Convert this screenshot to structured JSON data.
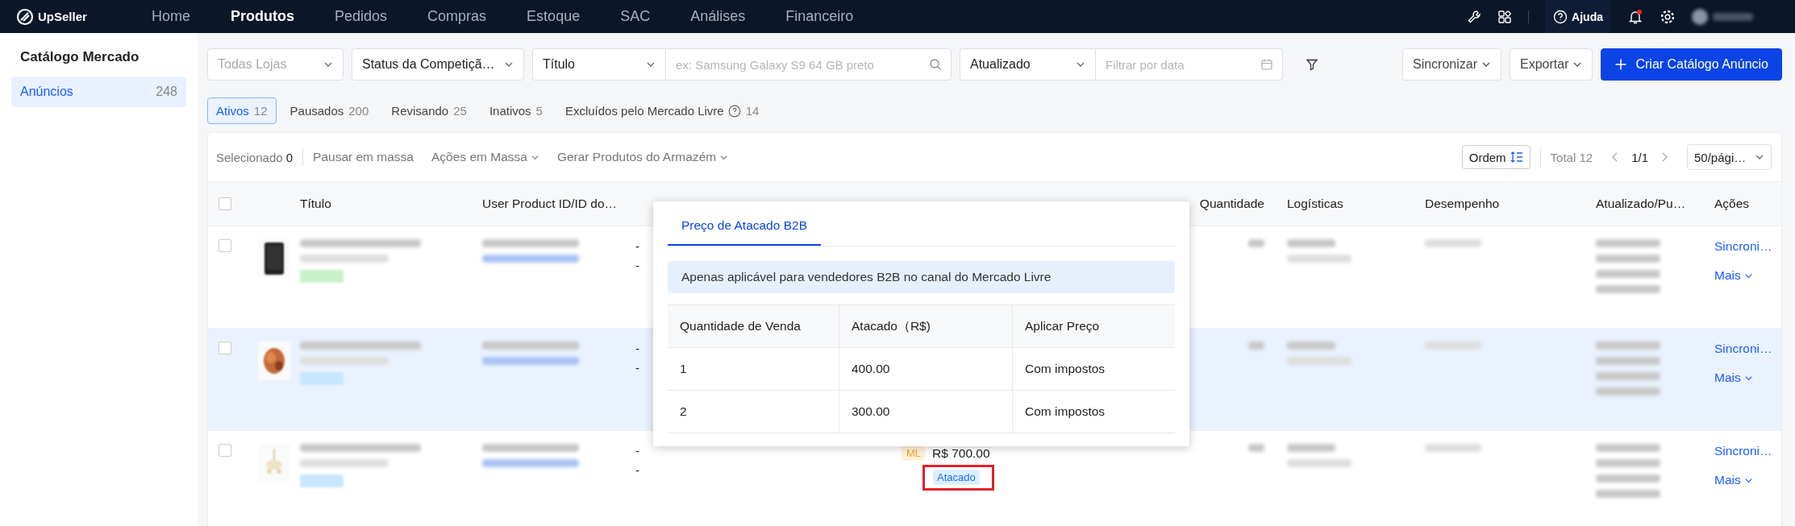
{
  "topbar": {
    "logo": "UpSeller",
    "nav": [
      {
        "label": "Home",
        "selected": false
      },
      {
        "label": "Produtos",
        "selected": true
      },
      {
        "label": "Pedidos",
        "selected": false
      },
      {
        "label": "Compras",
        "selected": false
      },
      {
        "label": "Estoque",
        "selected": false
      },
      {
        "label": "SAC",
        "selected": false
      },
      {
        "label": "Análises",
        "selected": false
      },
      {
        "label": "Financeiro",
        "selected": false
      }
    ],
    "help": "Ajuda",
    "notification": true
  },
  "sidebar": {
    "title": "Catálogo Mercado",
    "items": [
      {
        "label": "Anúncios",
        "count": "248",
        "selected": true
      }
    ]
  },
  "filters": {
    "store": {
      "placeholder": "Todas Lojas"
    },
    "status": {
      "value": "Status da Competiçã…"
    },
    "search_by": {
      "value": "Título"
    },
    "search": {
      "placeholder": "ex: Samsung Galaxy S9 64 GB preto"
    },
    "date_by": {
      "value": "Atualizado"
    },
    "date": {
      "placeholder": "Filtrar por data"
    }
  },
  "actions": [
    {
      "label": "Sincronizar",
      "kind": "menu"
    },
    {
      "label": "Exportar",
      "kind": "menu"
    },
    {
      "label": "Criar Catálogo Anúncio",
      "kind": "primary"
    }
  ],
  "tabs": [
    {
      "label": "Ativos",
      "count": "12",
      "selected": true,
      "help": false
    },
    {
      "label": "Pausados",
      "count": "200",
      "selected": false,
      "help": false
    },
    {
      "label": "Revisando",
      "count": "25",
      "selected": false,
      "help": false
    },
    {
      "label": "Inativos",
      "count": "5",
      "selected": false,
      "help": false
    },
    {
      "label": "Excluídos pelo Mercado Livre",
      "count": "14",
      "selected": false,
      "help": true
    }
  ],
  "toolbar": {
    "selected_label": "Selecionado",
    "selected_count": "0",
    "bulk": [
      {
        "label": "Pausar em massa",
        "menu": false
      },
      {
        "label": "Ações em Massa",
        "menu": true
      },
      {
        "label": "Gerar Produtos do Armazém",
        "menu": true
      }
    ],
    "sort": "Ordem",
    "total": "Total 12",
    "page": "1/1",
    "page_size": "50/pági…"
  },
  "table": {
    "select_all_checked": false,
    "columns": [
      "Título",
      "User Product ID/ID do…",
      "Quantidade",
      "Logísticas",
      "Desempenho",
      "Atualizado/Pu…",
      "Ações"
    ],
    "rows": [
      {
        "checked": false,
        "highlighted": false,
        "sku": [
          "-",
          "-"
        ],
        "actions": [
          "Sincroni…",
          "Mais"
        ]
      },
      {
        "checked": false,
        "highlighted": true,
        "sku": [
          "-",
          "-"
        ],
        "actions": [
          "Sincroni…",
          "Mais"
        ]
      },
      {
        "checked": false,
        "highlighted": false,
        "sku": [
          "-",
          "-"
        ],
        "price_source": "ML",
        "price": "R$ 700.00",
        "price_badge": "Atacado",
        "actions": [
          "Sincroni…",
          "Mais"
        ]
      }
    ]
  },
  "popover": {
    "tabs": [
      {
        "label": "Preço de Atacado B2B",
        "selected": true
      }
    ],
    "notice": "Apenas aplicável para vendedores B2B no canal do Mercado Livre",
    "columns": [
      "Quantidade de Venda",
      "Atacado（R$)",
      "Aplicar Preço"
    ],
    "rows": [
      [
        "1",
        "400.00",
        "Com impostos"
      ],
      [
        "2",
        "300.00",
        "Com impostos"
      ]
    ]
  }
}
